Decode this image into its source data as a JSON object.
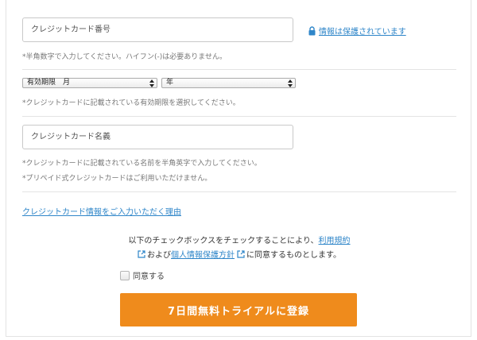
{
  "card_number": {
    "placeholder": "クレジットカード番号",
    "hint": "*半角数字で入力してください。ハイフン(-)は必要ありません。"
  },
  "secure_notice": {
    "icon": "lock-icon",
    "label": "情報は保護されています"
  },
  "expiry": {
    "month_select": "有効期限　月",
    "year_select": "年",
    "hint": "*クレジットカードに記載されている有効期限を選択してください。"
  },
  "card_name": {
    "placeholder": "クレジットカード名義",
    "hint_1": "*クレジットカードに記載されている名前を半角英字で入力してください。",
    "hint_2": "*プリペイド式クレジットカードはご利用いただけません。"
  },
  "reason_link": "クレジットカード情報をご入力いただく理由",
  "consent": {
    "line1_prefix": "以下のチェックボックスをチェックすることにより、",
    "terms_link": "利用規約",
    "line2_mid": "および",
    "privacy_link": "個人情報保護方針",
    "line2_suffix": "に同意するものとします。"
  },
  "agree_checkbox": {
    "label": "同意する",
    "checked": false
  },
  "submit_button": "7日間無料トライアルに登録",
  "colors": {
    "link": "#2f86c9",
    "button": "#ef8b1c",
    "hint": "#777777"
  }
}
